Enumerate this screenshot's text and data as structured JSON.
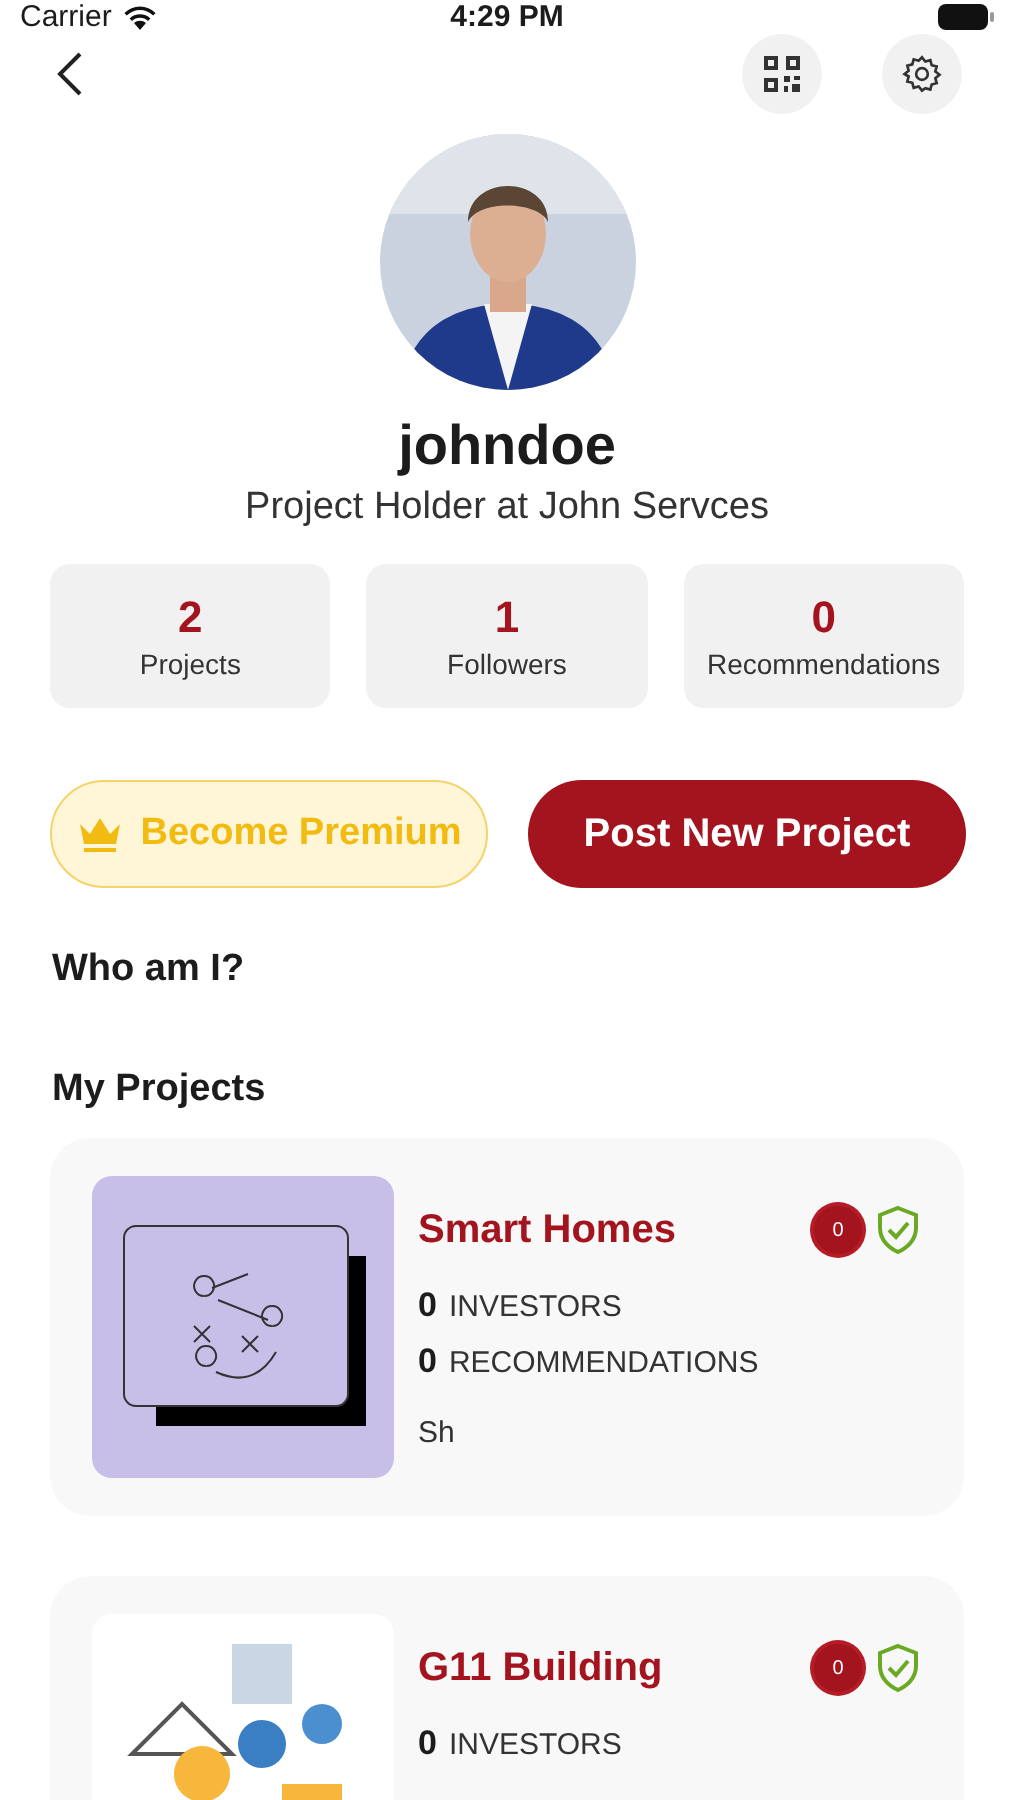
{
  "status_bar": {
    "carrier": "Carrier",
    "time": "4:29 PM"
  },
  "profile": {
    "username": "johndoe",
    "subtitle": "Project Holder at John Servces"
  },
  "stats": [
    {
      "value": "2",
      "label": "Projects"
    },
    {
      "value": "1",
      "label": "Followers"
    },
    {
      "value": "0",
      "label": "Recommendations"
    }
  ],
  "actions": {
    "premium": "Become Premium",
    "post": "Post New Project"
  },
  "sections": {
    "about": "Who am I?",
    "projects": "My Projects"
  },
  "projects": [
    {
      "title": "Smart Homes",
      "badge": "0",
      "verified": true,
      "kind": "illustration",
      "metrics": [
        {
          "value": "0",
          "label": "INVESTORS"
        },
        {
          "value": "0",
          "label": "RECOMMENDATIONS"
        }
      ],
      "description": "Sh"
    },
    {
      "title": "G11 Building",
      "badge": "0",
      "verified": true,
      "kind": "picture",
      "metrics": [
        {
          "value": "0",
          "label": "INVESTORS"
        }
      ]
    }
  ]
}
